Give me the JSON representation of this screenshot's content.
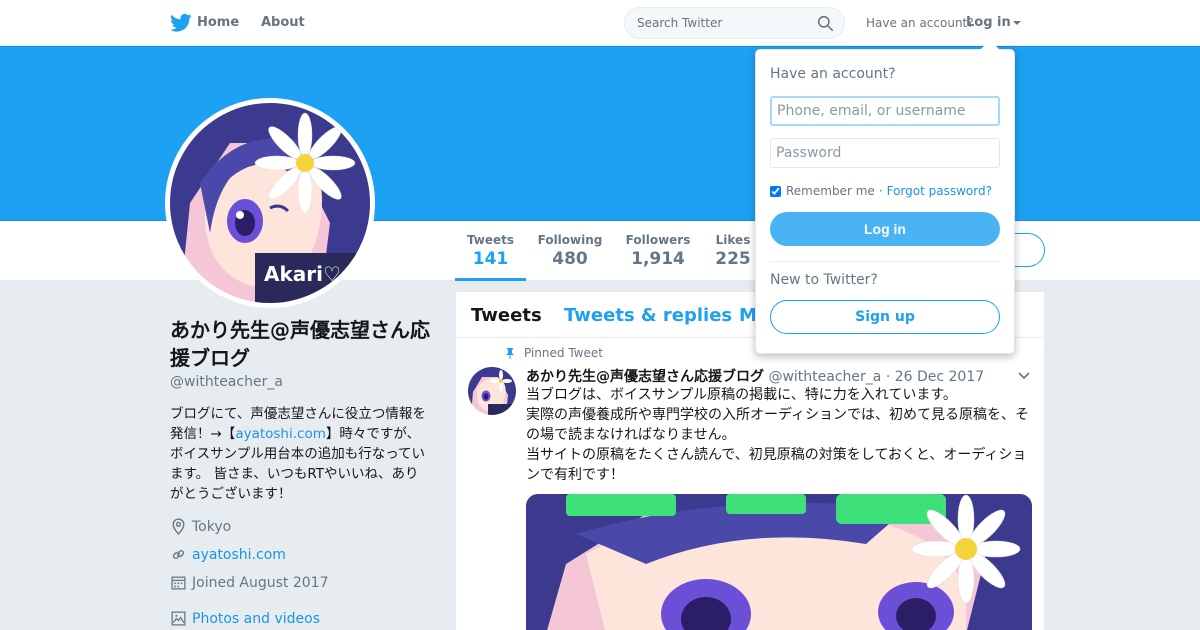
{
  "nav": {
    "home_label": "Home",
    "about_label": "About",
    "search_placeholder": "Search Twitter",
    "have_account": "Have an account?",
    "login_label": "Log in",
    "logo_icon": "twitter-bird-icon",
    "accent": "#1da1f2"
  },
  "profile": {
    "name": "あかり先生@声優志望さん応援ブログ",
    "handle": "@withteacher_a",
    "bio_part1": "ブログにて、声優志望さんに役立つ情報を発信！→【",
    "bio_link": "ayatoshi.com",
    "bio_part2": "】時々ですが、ボイスサンプル用台本の追加も行なっています。 皆さま、いつもRTやいいね、ありがとうございます！",
    "location": "Tokyo",
    "url": "ayatoshi.com",
    "joined": "Joined August 2017",
    "photos_label": "Photos and videos",
    "avatar_text": "Akari"
  },
  "stats": {
    "tweets_label": "Tweets",
    "tweets_value": "141",
    "following_label": "Following",
    "following_value": "480",
    "followers_label": "Followers",
    "followers_value": "1,914",
    "likes_label": "Likes",
    "likes_value": "225"
  },
  "timeline": {
    "tabs": [
      "Tweets",
      "Tweets & replies",
      "M"
    ],
    "pinned_label": "Pinned Tweet",
    "tweet": {
      "author": "あかり先生@声優志望さん応援ブログ",
      "handle": "@withteacher_a",
      "date": "26 Dec 2017",
      "lines": [
        "当ブログは、ボイスサンプル原稿の掲載に、特に力を入れています。",
        "実際の声優養成所や専門学校の入所オーディションでは、初めて見る原稿を、その場で読まなければなりません。",
        "当サイトの原稿をたくさん読んで、初見原稿の対策をしておくと、オーディションで有利です！"
      ]
    }
  },
  "login_dropdown": {
    "title": "Have an account?",
    "username_placeholder": "Phone, email, or username",
    "password_placeholder": "Password",
    "remember_label": "Remember me",
    "separator": "·",
    "forgot_label": "Forgot password?",
    "login_button": "Log in",
    "new_label": "New to Twitter?",
    "signup_button": "Sign up"
  }
}
